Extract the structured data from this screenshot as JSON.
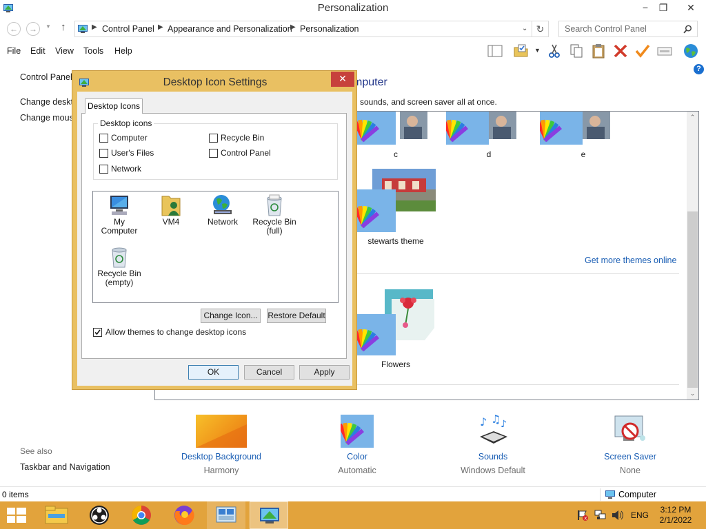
{
  "window": {
    "title": "Personalization",
    "controls": {
      "minimize": "−",
      "restore": "❐",
      "close": "✕"
    }
  },
  "address": {
    "crumbs": [
      "Control Panel",
      "Appearance and Personalization",
      "Personalization"
    ],
    "search_placeholder": "Search Control Panel"
  },
  "menu": {
    "items": [
      "File",
      "Edit",
      "View",
      "Tools",
      "Help"
    ]
  },
  "toolbar": {
    "icons": [
      "layout-icon",
      "folder-check-icon",
      "dropdown-icon",
      "cut-icon",
      "copy-icon",
      "paste-icon",
      "delete-icon",
      "properties-check-icon",
      "panel-icon",
      "globe-icon"
    ]
  },
  "leftnav": {
    "items": [
      "Control Panel",
      "Change deskto",
      "Change mous"
    ],
    "see_also_label": "See also",
    "see_also_items": [
      "Taskbar and Navigation"
    ]
  },
  "content": {
    "heading": "mputer",
    "subheading": "sounds, and screen saver all at once.",
    "themes_row1": [
      "c",
      "d",
      "e"
    ],
    "themes_row2": [
      "stewarts theme"
    ],
    "get_more": "Get more themes online",
    "basic_themes": [
      "Flowers"
    ]
  },
  "bottom": {
    "items": [
      {
        "label": "Desktop Background",
        "sub": "Harmony"
      },
      {
        "label": "Color",
        "sub": "Automatic"
      },
      {
        "label": "Sounds",
        "sub": "Windows Default"
      },
      {
        "label": "Screen Saver",
        "sub": "None"
      }
    ]
  },
  "status": {
    "items_count": "0 items",
    "location": "Computer"
  },
  "dialog": {
    "title": "Desktop Icon Settings",
    "tab": "Desktop Icons",
    "group_title": "Desktop icons",
    "checkboxes": [
      {
        "label": "Computer",
        "checked": false
      },
      {
        "label": "Recycle Bin",
        "checked": false
      },
      {
        "label": "User's Files",
        "checked": false
      },
      {
        "label": "Control Panel",
        "checked": false
      },
      {
        "label": "Network",
        "checked": false
      }
    ],
    "icons": [
      {
        "line1": "My Computer",
        "line2": ""
      },
      {
        "line1": "VM4",
        "line2": ""
      },
      {
        "line1": "Network",
        "line2": ""
      },
      {
        "line1": "Recycle Bin",
        "line2": "(full)"
      },
      {
        "line1": "Recycle Bin",
        "line2": "(empty)"
      }
    ],
    "change_icon": "Change Icon...",
    "restore_default": "Restore Default",
    "allow_themes": "Allow themes to change desktop icons",
    "allow_themes_checked": true,
    "ok": "OK",
    "cancel": "Cancel",
    "apply": "Apply"
  },
  "taskbar": {
    "apps": [
      "file-explorer-icon",
      "obs-icon",
      "chrome-icon",
      "firefox-icon",
      "control-panel-icon",
      "personalization-icon"
    ],
    "lang": "ENG",
    "time": "3:12 PM",
    "date": "2/1/2022"
  },
  "colors": {
    "dialog_frame": "#e9c062",
    "taskbar": "#e2a33c",
    "link": "#1a5eb4",
    "heading": "#1e3287",
    "close_red": "#c7413c"
  }
}
